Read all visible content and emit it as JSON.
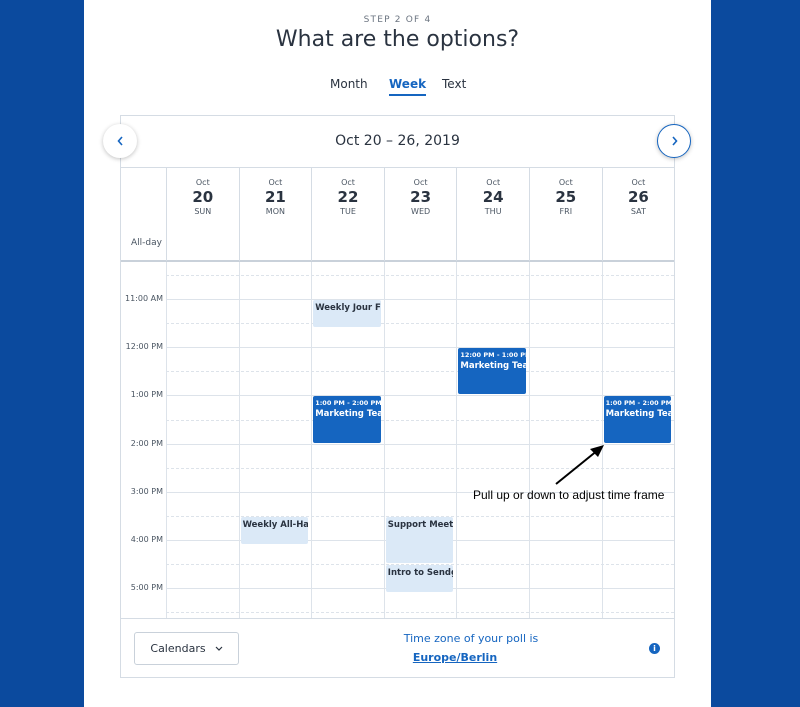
{
  "step_label": "STEP 2 OF 4",
  "title": "What are the options?",
  "tabs": [
    {
      "label": "Month",
      "active": false
    },
    {
      "label": "Week",
      "active": true
    },
    {
      "label": "Text",
      "active": false
    }
  ],
  "calendar": {
    "range": "Oct 20 – 26, 2019",
    "allday_label": "All-day",
    "days": [
      {
        "month": "Oct",
        "num": "20",
        "weekday": "SUN"
      },
      {
        "month": "Oct",
        "num": "21",
        "weekday": "MON"
      },
      {
        "month": "Oct",
        "num": "22",
        "weekday": "TUE"
      },
      {
        "month": "Oct",
        "num": "23",
        "weekday": "WED"
      },
      {
        "month": "Oct",
        "num": "24",
        "weekday": "THU"
      },
      {
        "month": "Oct",
        "num": "25",
        "weekday": "FRI"
      },
      {
        "month": "Oct",
        "num": "26",
        "weekday": "SAT"
      }
    ],
    "times": [
      "11:00 AM",
      "12:00 PM",
      "1:00 PM",
      "2:00 PM",
      "3:00 PM",
      "4:00 PM",
      "5:00 PM"
    ],
    "events": [
      {
        "day": 2,
        "start": 11.0,
        "end": 11.6,
        "style": "light",
        "name": "Weekly Jour Fix"
      },
      {
        "day": 2,
        "start": 13.0,
        "end": 14.0,
        "style": "dark",
        "time": "1:00 PM - 2:00 PM",
        "name": "Marketing Team"
      },
      {
        "day": 4,
        "start": 12.0,
        "end": 13.0,
        "style": "dark",
        "time": "12:00 PM - 1:00 PM",
        "name": "Marketing Team"
      },
      {
        "day": 6,
        "start": 13.0,
        "end": 14.0,
        "style": "dark",
        "time": "1:00 PM - 2:00 PM",
        "name": "Marketing Team"
      },
      {
        "day": 1,
        "start": 15.5,
        "end": 16.1,
        "style": "light",
        "name": "Weekly All-Hands"
      },
      {
        "day": 3,
        "start": 15.5,
        "end": 16.5,
        "style": "light",
        "name": "Support Meeting"
      },
      {
        "day": 3,
        "start": 16.5,
        "end": 17.1,
        "style": "light",
        "name": "Intro to Sendgrid"
      }
    ]
  },
  "footer": {
    "calendars_label": "Calendars",
    "timezone_label": "Time zone of your poll is",
    "timezone_value": "Europe/Berlin"
  },
  "annotation": "Pull up or down to adjust time frame",
  "colors": {
    "accent": "#1565c0",
    "background": "#0b4a9e",
    "event_light": "#dbe9f7"
  },
  "icons": [
    "chevron-left-icon",
    "chevron-right-icon",
    "chevron-down-icon",
    "info-icon"
  ]
}
